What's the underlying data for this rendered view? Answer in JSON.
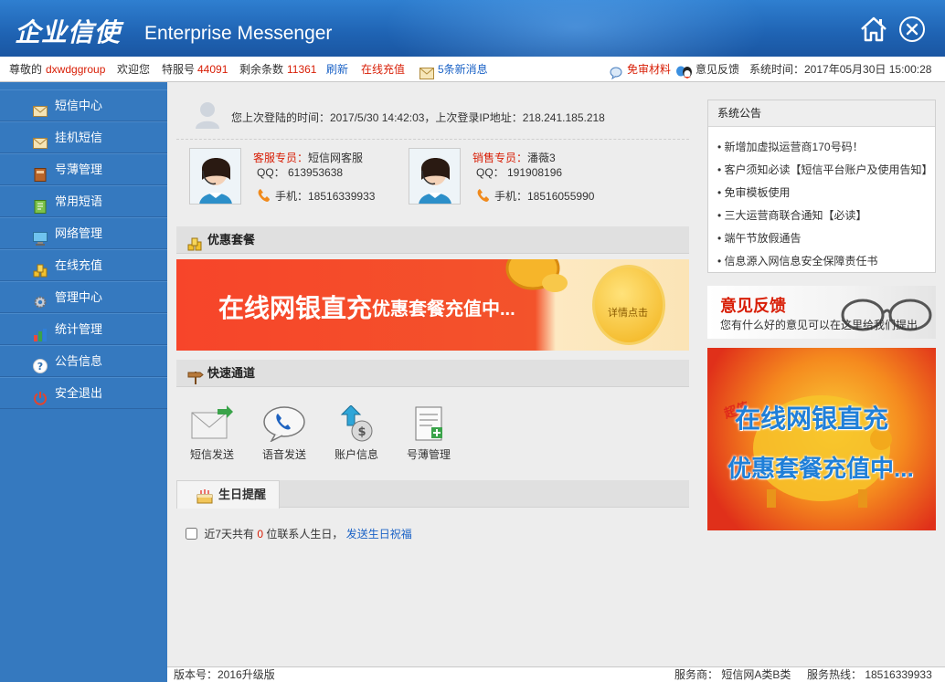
{
  "header": {
    "logo_cn": "企业信使",
    "logo_en": "Enterprise Messenger"
  },
  "topbar": {
    "greeting_prefix": "尊敬的",
    "username": "dxwdggroup",
    "greeting_suffix": "欢迎您",
    "special_label": "特服号",
    "special_number": "44091",
    "remaining_label": "剩余条数",
    "remaining_count": "11361",
    "refresh": "刷新",
    "recharge": "在线充值",
    "messages": "5条新消息",
    "audit_free": "免审材料",
    "feedback": "意见反馈",
    "system_time_label": "系统时间：",
    "system_time": "2017年05月30日 15:00:28"
  },
  "sidebar": {
    "items": [
      {
        "label": "短信中心",
        "icon": "envelope-icon"
      },
      {
        "label": "挂机短信",
        "icon": "envelope-icon"
      },
      {
        "label": "号薄管理",
        "icon": "addressbook-icon"
      },
      {
        "label": "常用短语",
        "icon": "notebook-icon"
      },
      {
        "label": "网络管理",
        "icon": "monitor-icon"
      },
      {
        "label": "在线充值",
        "icon": "coins-icon"
      },
      {
        "label": "管理中心",
        "icon": "gear-icon"
      },
      {
        "label": "统计管理",
        "icon": "barchart-icon"
      },
      {
        "label": "公告信息",
        "icon": "help-icon"
      },
      {
        "label": "安全退出",
        "icon": "power-icon"
      }
    ]
  },
  "main": {
    "last_login": "您上次登陆的时间：2017/5/30 14:42:03，上次登录IP地址：218.241.185.218",
    "service": {
      "role": "客服专员：",
      "name": "短信网客服",
      "qq": "QQ：  613953638",
      "phone": "手机：18516339933"
    },
    "sales": {
      "role": "销售专员：",
      "name": "潘薇3",
      "qq": "QQ：  191908196",
      "phone": "手机：18516055990"
    },
    "package_title": "优惠套餐",
    "banner_main": "在线网银直充",
    "banner_sub": "优惠套餐充值中...",
    "banner_coin": "详情点击",
    "quick_title": "快速通道",
    "quick_items": [
      "短信发送",
      "语音发送",
      "账户信息",
      "号薄管理"
    ],
    "birthday_tab": "生日提醒",
    "birthday_pre": "近7天共有",
    "birthday_count": "0",
    "birthday_post": "位联系人生日，",
    "birthday_link": "发送生日祝福"
  },
  "notice": {
    "title": "系统公告",
    "items": [
      "新增加虚拟运营商170号码！",
      "客户须知必读【短信平台账户及使用告知】",
      "免审模板使用",
      "三大运营商联合通知【必读】",
      "端午节放假通告",
      "信息源入网信息安全保障责任书"
    ]
  },
  "feedback_banner": {
    "title": "意见反馈",
    "desc": "您有什么好的意见可以在这里给我们提出"
  },
  "promo": {
    "line1": "在线网银直充",
    "line2": "优惠套餐充值中...",
    "tag": "超值"
  },
  "footer": {
    "version": "版本号：2016升级版",
    "provider": "服务商：  短信网A类B类",
    "hotline": "服务热线：  18516339933"
  },
  "colors": {
    "accent": "#1f63b3",
    "sidebar": "#3579bf",
    "highlight": "#d81e06",
    "link": "#1a62c6"
  }
}
